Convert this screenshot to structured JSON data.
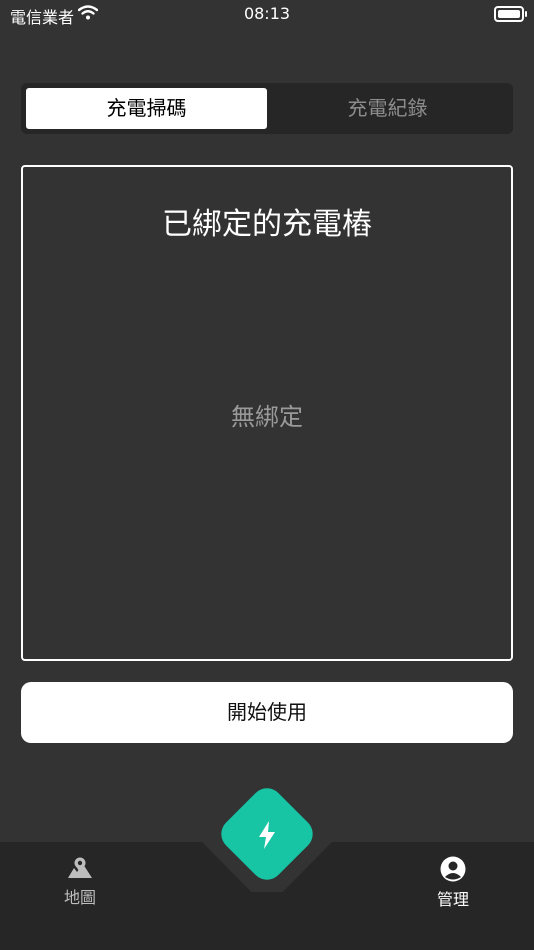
{
  "status_bar": {
    "carrier": "電信業者",
    "time": "08:13"
  },
  "segmented": {
    "tabs": [
      {
        "label": "充電掃碼",
        "active": true
      },
      {
        "label": "充電紀錄",
        "active": false
      }
    ]
  },
  "bound_panel": {
    "title": "已綁定的充電樁",
    "empty_text": "無綁定"
  },
  "start_button": {
    "label": "開始使用"
  },
  "tab_bar": {
    "items": [
      {
        "label": "地圖",
        "icon": "map-pin-icon"
      },
      {
        "label": "管理",
        "icon": "person-icon",
        "active": true
      }
    ],
    "center_icon": "lightning-bolt-icon"
  },
  "colors": {
    "background": "#333333",
    "accent": "#17c4a4",
    "tab_bar": "#262626"
  }
}
